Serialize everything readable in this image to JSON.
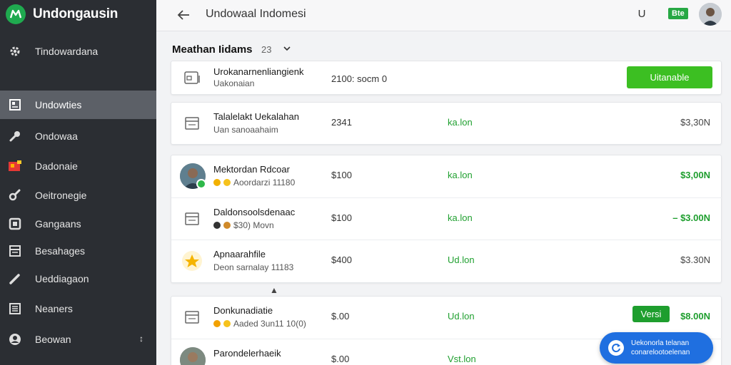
{
  "app": {
    "brand": "Undongausin"
  },
  "sidebar": {
    "items": [
      {
        "label": "Tindowardana",
        "icon": "gear-icon"
      },
      {
        "label": "Undowties",
        "icon": "document-icon",
        "active": true
      },
      {
        "label": "Ondowaa",
        "icon": "wrench-icon"
      },
      {
        "label": "Dadonaie",
        "icon": "image-icon"
      },
      {
        "label": "Oeitronegie",
        "icon": "tool-icon"
      },
      {
        "label": "Gangaans",
        "icon": "square-icon"
      },
      {
        "label": "Besahages",
        "icon": "folder-icon"
      },
      {
        "label": "Ueddiagaon",
        "icon": "pencil-icon"
      },
      {
        "label": "Neaners",
        "icon": "list-icon"
      },
      {
        "label": "Beowan",
        "icon": "user-icon"
      }
    ]
  },
  "topbar": {
    "title": "Undowaal Indomesi",
    "u_label": "U",
    "badge": "Bte"
  },
  "section": {
    "title": "Meathan Iidams",
    "count": "23"
  },
  "rows_top": [
    {
      "name": "Urokanarnenliangienk",
      "sub": "Uakonaian",
      "amount": "2100: socm 0",
      "button": "Uitanable",
      "icon": "wallet-icon"
    }
  ],
  "rows_single": [
    {
      "name": "Talalelakt Uekalahan",
      "sub": "Uan sanoaahaim",
      "amount": "2341",
      "status": "ka.lon",
      "price": "$3,30N",
      "icon": "card-icon"
    }
  ],
  "rows_group1": [
    {
      "name": "Mektordan Rdcoar",
      "sub": "Aoordarzi 11180",
      "amount": "$100",
      "status": "ka.lon",
      "price": "$3,00N",
      "price_green": true,
      "icon": "avatar"
    },
    {
      "name": "Daldonsoolsdenaac",
      "sub": "$30) Movn",
      "amount": "$100",
      "status": "ka.lon",
      "price": "– $3.00N",
      "price_green": true,
      "icon": "card-icon"
    },
    {
      "name": "Apnaarahfile",
      "sub": "Deon sarnalay 11183",
      "amount": "$400",
      "status": "Ud.lon",
      "price": "$3.30N",
      "price_green": false,
      "icon": "star-icon"
    }
  ],
  "rows_group2": [
    {
      "name": "Donkunadiatie",
      "sub": "Aaded 3un11 10(0)",
      "amount": "$.00",
      "status": "Ud.lon",
      "button": "Versi",
      "price": "$8.00N",
      "price_green": true,
      "icon": "card-icon"
    },
    {
      "name": "Parondelerhaeik",
      "sub": "",
      "amount": "$.00",
      "status": "Vst.lon",
      "icon": "avatar"
    }
  ],
  "floating": {
    "line1": "Uekonorla telanan",
    "line2": "conarelootoelenan"
  },
  "colors": {
    "accent_green": "#3cbf22",
    "sidebar_bg": "#2b2e33",
    "float_blue": "#1f6fe0"
  }
}
